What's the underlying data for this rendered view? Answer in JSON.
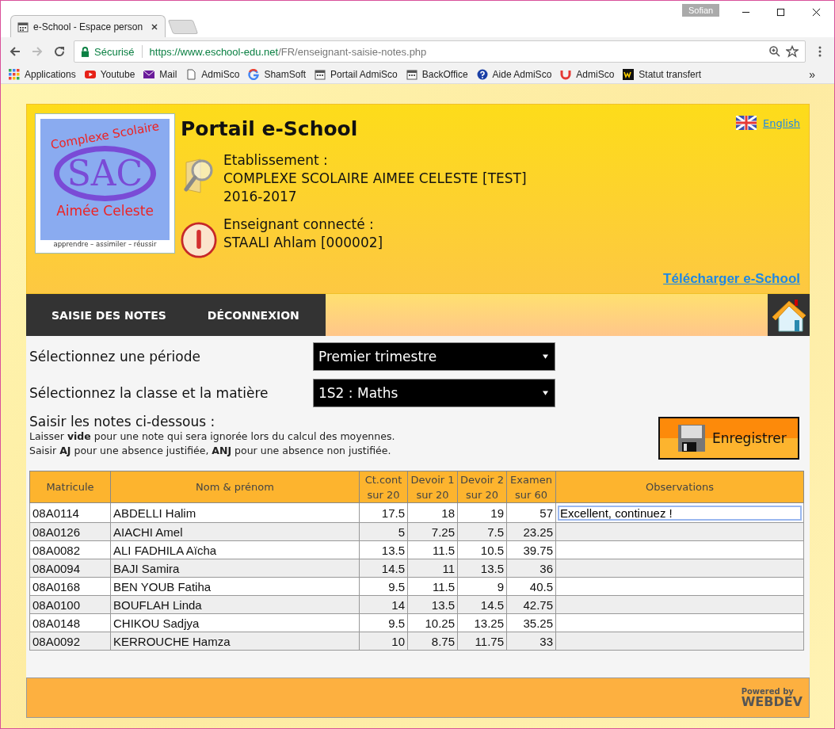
{
  "browser": {
    "tab_title": "e-School - Espace person",
    "user": "Sofian",
    "secure_label": "Sécurisé",
    "url_host": "https://www.eschool-edu.net",
    "url_path": "/FR/enseignant-saisie-notes.php",
    "bookmarks": [
      {
        "label": "Applications"
      },
      {
        "label": "Youtube"
      },
      {
        "label": "Mail"
      },
      {
        "label": "AdmiSco"
      },
      {
        "label": "ShamSoft"
      },
      {
        "label": "Portail AdmiSco"
      },
      {
        "label": "BackOffice"
      },
      {
        "label": "Aide AdmiSco"
      },
      {
        "label": "AdmiSco"
      },
      {
        "label": "Statut transfert"
      }
    ],
    "more": "»"
  },
  "header": {
    "logo": {
      "top": "Complexe Scolaire",
      "initials": "SAC",
      "name": "Aimée Celeste",
      "motto": "apprendre – assimiler – réussir"
    },
    "title": "Portail e-School",
    "language_link": "English",
    "school_label": "Etablissement :",
    "school_name": "COMPLEXE SCOLAIRE AIMEE CELESTE [TEST]",
    "school_year": "2016-2017",
    "teacher_label": "Enseignant connecté :",
    "teacher_name": "STAALI Ahlam [000002]",
    "download_link": "Télécharger e-School"
  },
  "nav": [
    "SAISIE DES NOTES",
    "DÉCONNEXION"
  ],
  "form": {
    "period_label": "Sélectionnez une période",
    "period_value": "Premier trimestre",
    "class_label": "Sélectionnez la classe et la matière",
    "class_value": "1S2 : Maths",
    "instructions_title": "Saisir les notes ci-dessous :",
    "instructions": [
      "Laisser **vide** pour une note qui sera ignorée lors du calcul des moyennes.",
      "Saisir **AJ** pour une absence justifiée, **ANJ** pour une absence non justifiée."
    ],
    "save_button": "Enregistrer"
  },
  "table": {
    "columns": [
      {
        "label": "Matricule"
      },
      {
        "label": "Nom & prénom"
      },
      {
        "label": "Ct.cont",
        "sub": "sur 20"
      },
      {
        "label": "Devoir 1",
        "sub": "sur 20"
      },
      {
        "label": "Devoir 2",
        "sub": "sur 20"
      },
      {
        "label": "Examen",
        "sub": "sur 60"
      },
      {
        "label": "Observations"
      }
    ],
    "rows": [
      {
        "id": "08A0114",
        "name": "ABDELLI Halim",
        "grades": [
          "17.5",
          "18",
          "19",
          "57"
        ],
        "observation": "Excellent, continuez !"
      },
      {
        "id": "08A0126",
        "name": "AIACHI Amel",
        "grades": [
          "5",
          "7.25",
          "7.5",
          "23.25"
        ]
      },
      {
        "id": "08A0082",
        "name": "ALI FADHILA Aïcha",
        "grades": [
          "13.5",
          "11.5",
          "10.5",
          "39.75"
        ]
      },
      {
        "id": "08A0094",
        "name": "BAJI Samira",
        "grades": [
          "14.5",
          "11",
          "13.5",
          "36"
        ]
      },
      {
        "id": "08A0168",
        "name": "BEN YOUB Fatiha",
        "grades": [
          "9.5",
          "11.5",
          "9",
          "40.5"
        ]
      },
      {
        "id": "08A0100",
        "name": "BOUFLAH Linda",
        "grades": [
          "14",
          "13.5",
          "14.5",
          "42.75"
        ]
      },
      {
        "id": "08A0148",
        "name": "CHIKOU Sadjya",
        "grades": [
          "9.5",
          "10.25",
          "13.25",
          "35.25"
        ]
      },
      {
        "id": "08A0092",
        "name": "KERROUCHE Hamza",
        "grades": [
          "10",
          "8.75",
          "11.75",
          "33"
        ]
      }
    ]
  },
  "footer": {
    "powered": "Powered by",
    "brand": "WEBDEV"
  }
}
